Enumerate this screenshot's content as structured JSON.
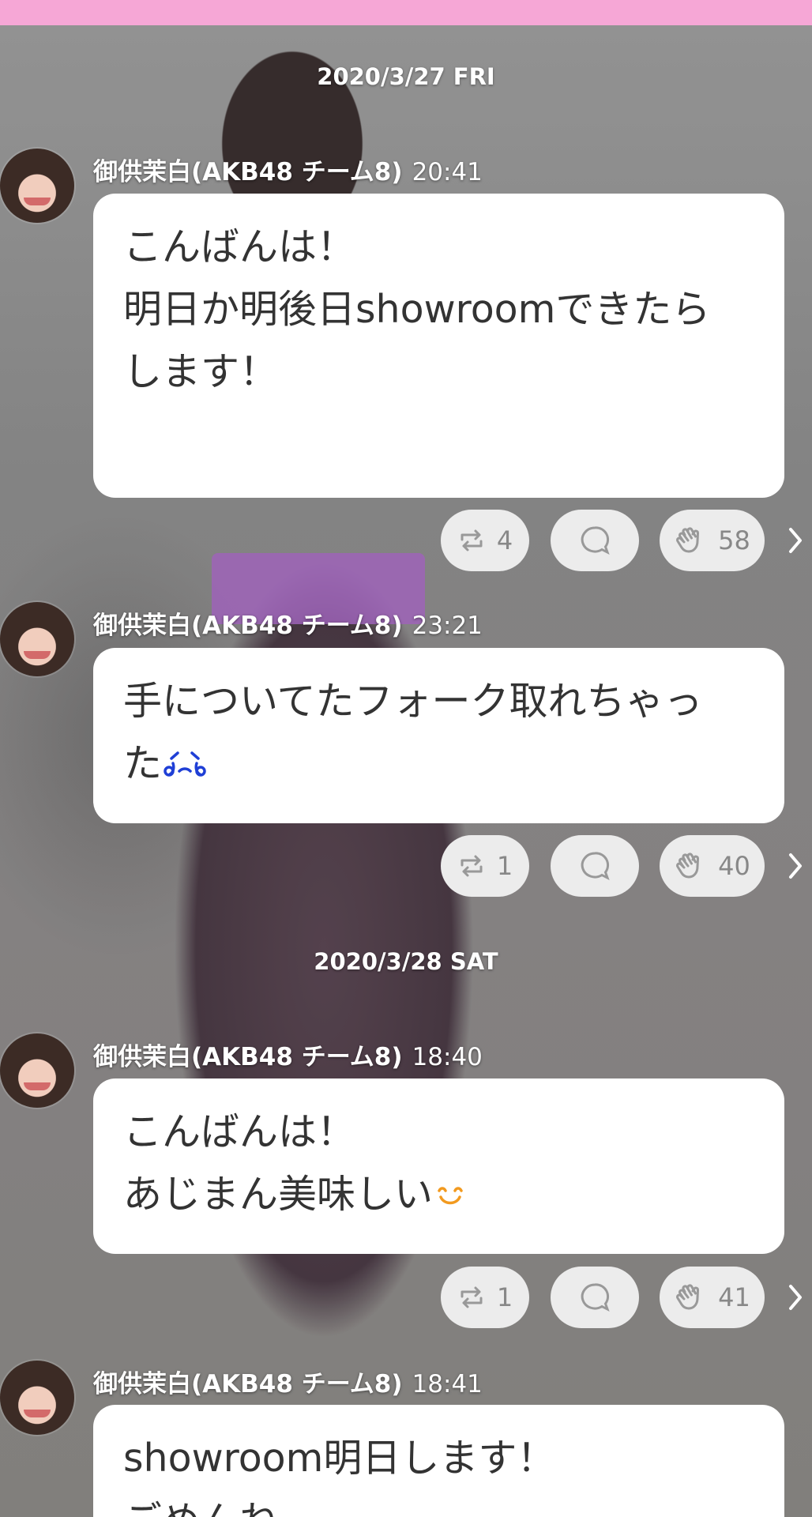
{
  "timeline": {
    "dates": [
      "2020/3/27 FRI",
      "2020/3/28 SAT"
    ],
    "author": "御供茉白(AKB48 チーム8)",
    "messages": [
      {
        "time": "20:41",
        "text": "こんばんは！\n明日か明後日showroomできたら\nします！",
        "emoji": "",
        "retweets": "4",
        "claps": "58"
      },
      {
        "time": "23:21",
        "text": "手についてたフォーク取れちゃっ\nた",
        "emoji": "crying-face-icon",
        "retweets": "1",
        "claps": "40"
      },
      {
        "time": "18:40",
        "text": "こんばんは！\nあじまん美味しい",
        "emoji": "smiling-face-icon",
        "retweets": "1",
        "claps": "41"
      },
      {
        "time": "18:41",
        "text": "showroom明日します！\nごめんね",
        "emoji": "",
        "retweets": "",
        "claps": ""
      }
    ]
  },
  "colors": {
    "status_bar": "#f6a7d6",
    "bubble": "#ffffff",
    "pill": "#ececec",
    "pill_text": "#888888",
    "message_text": "#333333"
  }
}
